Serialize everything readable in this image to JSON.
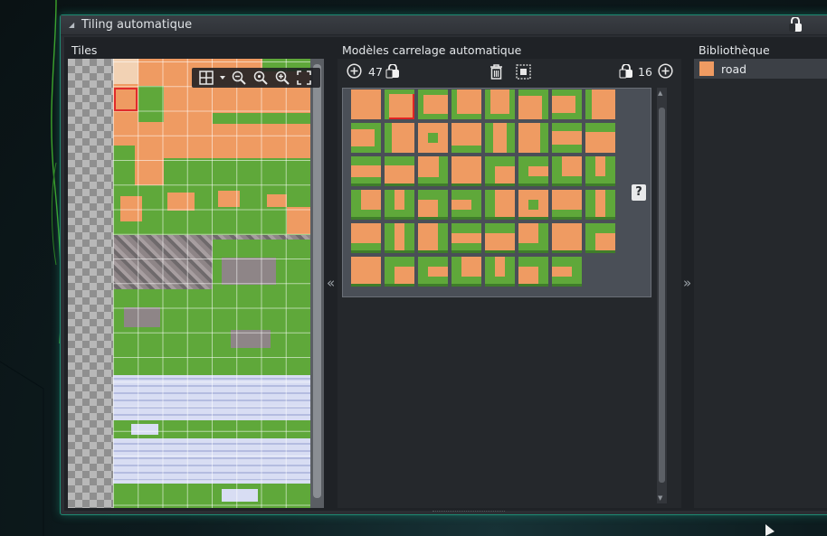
{
  "window": {
    "title": "Tiling automatique"
  },
  "tiles": {
    "label": "Tiles",
    "toolbar_icons": [
      "grid-icon",
      "zoom-out-icon",
      "zoom-reset-icon",
      "zoom-in-icon",
      "fullscreen-icon"
    ]
  },
  "models": {
    "label": "Modèles carrelage automatique",
    "tile_count": "47",
    "locked_count": "16",
    "help_button": "?"
  },
  "library": {
    "label": "Bibliothèque",
    "items": [
      {
        "label": "road",
        "color": "#ef9b62"
      }
    ]
  },
  "colors": {
    "accent": "#1d8a72",
    "tile_dirt": "#ef9b62",
    "tile_grass": "#5fa83a",
    "selection": "#e02b2b"
  }
}
